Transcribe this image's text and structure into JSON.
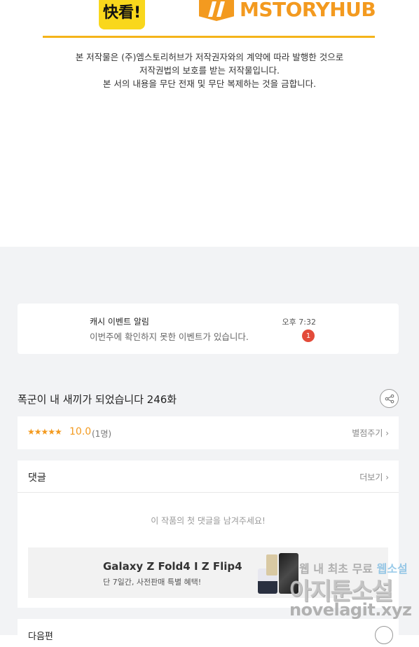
{
  "logos": {
    "left_text": "快看!",
    "right_text": "MSTORYHUB",
    "accent": "#f39a1f",
    "yellow": "#f9d71c"
  },
  "copyright": {
    "line1": "본 저작물은 (주)엠스토리허브가 저작권자와의 계약에 따라 발행한 것으로",
    "line2": "저작권법의 보호를 받는 저작물입니다.",
    "line3": "본 서의 내용을 무단 전재 및 무단 복제하는 것을 금합니다."
  },
  "notice": {
    "title": "캐시 이벤트 알림",
    "subtitle": "이번주에 확인하지 못한 이벤트가 있습니다.",
    "time": "오후 7:32",
    "badge": "1"
  },
  "episode": {
    "title": "폭군이 내 새끼가 되었습니다 246화",
    "share_icon": "share-icon"
  },
  "rating": {
    "stars": "★★★★★",
    "score": "10.0",
    "count": "(1명)",
    "rate_button": "별점주기 ›"
  },
  "comments": {
    "title": "댓글",
    "more_button": "더보기 ›",
    "empty_text": "이 작품의 첫 댓글을 남겨주세요!"
  },
  "ad": {
    "title": "Galaxy Z Fold4 I Z Flip4",
    "subtitle": "단 7일간, 사전판매 특별 혜택!"
  },
  "next": {
    "title": "다음편"
  },
  "watermark": {
    "line1_a": "웹 내 최초 무료",
    "line1_b": "웹소설",
    "line2": "아지툰소설",
    "line3": "novelagit.xyz"
  }
}
